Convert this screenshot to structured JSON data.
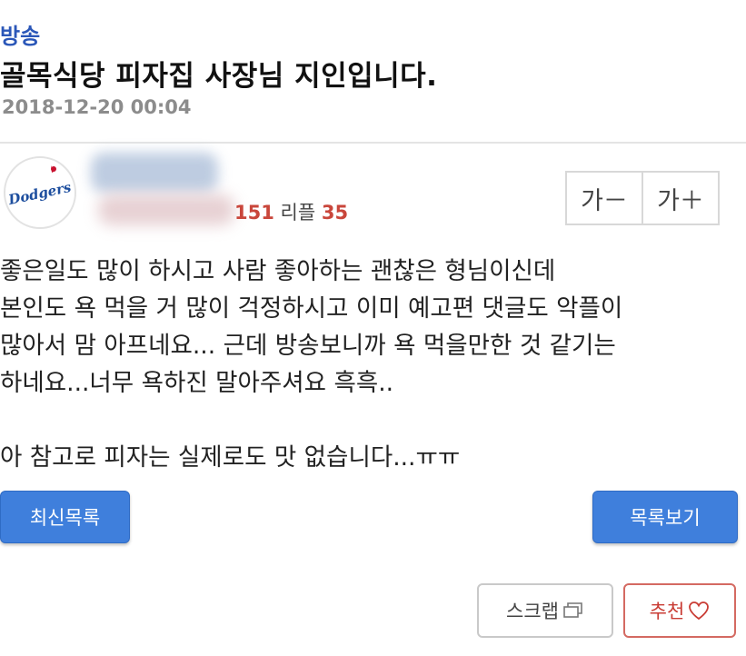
{
  "post": {
    "category": "방송",
    "title": "골목식당 피자집 사장님 지인입니다.",
    "date": "2018-12-20 00:04"
  },
  "author": {
    "avatar_icon": "dodgers-logo-icon",
    "avatar_text": "Dodgers",
    "views_partial": "151",
    "reply_label": "리플",
    "reply_count": "35"
  },
  "font_controls": {
    "decrease_label": "가－",
    "increase_label": "가＋"
  },
  "content": {
    "lines": [
      "좋은일도 많이 하시고 사람 좋아하는 괜찮은 형님이신데",
      "본인도 욕 먹을 거 많이 걱정하시고 이미 예고편 댓글도 악플이",
      "많아서 맘 아프네요... 근데 방송보니까 욕 먹을만한 것 같기는",
      "하네요...너무 욕하진 말아주셔요 흑흑..",
      "아 참고로 피자는 실제로도 맛 없습니다...ㅠㅠ"
    ]
  },
  "actions": {
    "latest_label": "최신목록",
    "list_label": "목록보기",
    "scrap_label": "스크랩",
    "recommend_label": "추천"
  },
  "colors": {
    "category": "#2b57b8",
    "button_blue": "#3f7fdc",
    "reply_count": "#c9463b",
    "recommend": "#c93c34"
  }
}
